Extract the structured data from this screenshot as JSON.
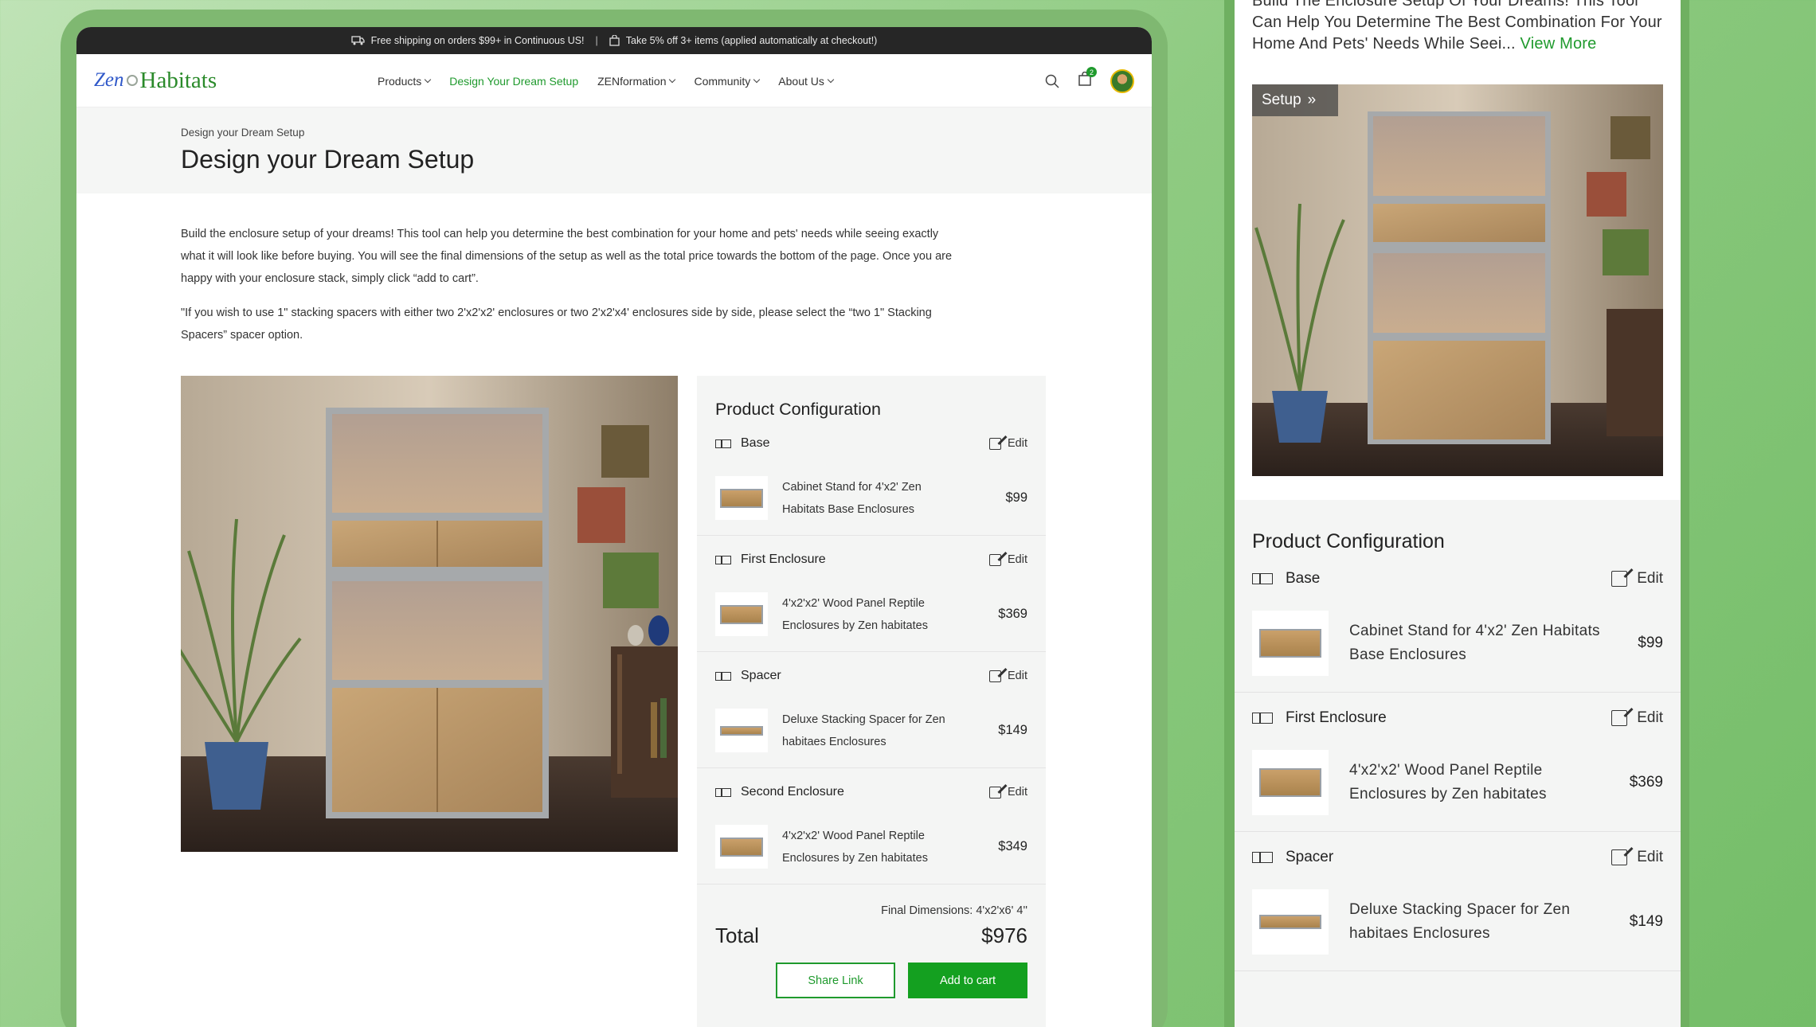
{
  "topbar": {
    "shipping": "Free shipping on orders $99+ in Continuous US!",
    "discount": "Take 5% off 3+ items (applied automatically at checkout!)"
  },
  "logo": {
    "part1": "Zen",
    "part2": "Habitats"
  },
  "nav": {
    "items": [
      {
        "label": "Products",
        "dropdown": true
      },
      {
        "label": "Design Your Dream Setup",
        "dropdown": false,
        "active": true
      },
      {
        "label": "ZENformation",
        "dropdown": true
      },
      {
        "label": "Community",
        "dropdown": true
      },
      {
        "label": "About Us",
        "dropdown": true
      }
    ],
    "cart_count": "2"
  },
  "hero": {
    "breadcrumb": "Design your Dream Setup",
    "title": "Design your Dream Setup"
  },
  "intro": {
    "p1": "Build the enclosure setup of your dreams! This tool can help you determine the best combination for your home and pets' needs while seeing exactly what it will look like before buying. You will see the final dimensions of the setup as well as the total price towards the bottom of the page. Once you are happy with your enclosure stack, simply click “add to cart”.",
    "p2": "\"If you wish to use 1\" stacking spacers with either two 2'x2'x2' enclosures or two 2'x2'x4' enclosures side by side, please select the “two 1\" Stacking Spacers” spacer option."
  },
  "config": {
    "title": "Product Configuration",
    "edit_label": "Edit",
    "sections": [
      {
        "label": "Base",
        "name": "Cabinet Stand for 4'x2' Zen Habitats Base Enclosures",
        "price": "$99"
      },
      {
        "label": "First Enclosure",
        "name": "4'x2'x2' Wood Panel Reptile Enclosures by Zen habitates",
        "price": "$369"
      },
      {
        "label": "Spacer",
        "name": "Deluxe Stacking Spacer for Zen habitaes Enclosures",
        "price": "$149"
      },
      {
        "label": "Second Enclosure",
        "name": "4'x2'x2' Wood Panel Reptile Enclosures by Zen habitates",
        "price": "$349"
      }
    ],
    "final_dimensions": "Final Dimensions: 4'x2'x6' 4''",
    "total_label": "Total",
    "total_value": "$976",
    "share_label": "Share Link",
    "add_label": "Add to cart"
  },
  "mobile": {
    "intro": "Build The Enclosure Setup Of Your Dreams! This Tool Can Help You Determine The Best Combination For Your Home And Pets' Needs While Seei...",
    "view_more": "View More",
    "badge": "Setup",
    "config_title": "Product Configuration",
    "edit_label": "Edit",
    "sections": [
      {
        "label": "Base",
        "name": "Cabinet Stand for 4'x2' Zen Habitats Base Enclosures",
        "price": "$99"
      },
      {
        "label": "First Enclosure",
        "name": "4'x2'x2'  Wood Panel Reptile Enclosures by Zen habitates",
        "price": "$369"
      },
      {
        "label": "Spacer",
        "name": "Deluxe Stacking Spacer for Zen habitaes Enclosures",
        "price": "$149"
      }
    ]
  },
  "colors": {
    "accent": "#1f9a2d",
    "topbar": "#262626",
    "panel": "#f4f5f4"
  }
}
